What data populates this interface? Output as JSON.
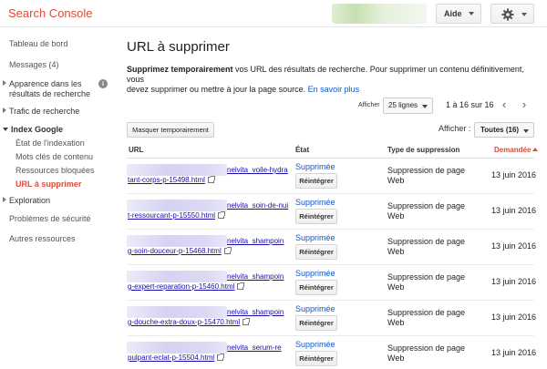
{
  "header": {
    "logo": "Search Console",
    "help_label": "Aide"
  },
  "sidebar": {
    "items": [
      {
        "label": "Tableau de bord"
      },
      {
        "label": "Messages (4)"
      },
      {
        "label_line1": "Apparence dans les",
        "label_line2": "résultats de recherche"
      },
      {
        "label": "Trafic de recherche"
      },
      {
        "label": "Index Google"
      },
      {
        "label": "État de l'indexation"
      },
      {
        "label": "Mots clés de contenu"
      },
      {
        "label": "Ressources bloquées"
      },
      {
        "label": "URL à supprimer"
      },
      {
        "label": "Exploration"
      },
      {
        "label": "Problèmes de sécurité"
      },
      {
        "label": "Autres ressources"
      }
    ],
    "info_icon": "i"
  },
  "main": {
    "title": "URL à supprimer",
    "desc_bold": "Supprimez temporairement",
    "desc_line1_rest": " vos URL des résultats de recherche. Pour supprimer un contenu définitivement, vous",
    "desc_line2": "devez supprimer ou mettre à jour la page source. ",
    "learn_more": "En savoir plus",
    "pager_label": "Afficher",
    "rows_value": "25 lignes",
    "range": "1 à 16 sur 16",
    "prev_icon": "‹",
    "next_icon": "›",
    "hide_button": "Masquer temporairement",
    "filter_label": "Afficher :",
    "filter_value": "Toutes (16)",
    "columns": {
      "url": "URL",
      "state": "État",
      "type": "Type de suppression",
      "requested": "Demandée"
    },
    "rows": [
      {
        "url1": "nelvita_voile-hydra",
        "url2": "tant-corps-p-15498.html",
        "state": "Supprimée",
        "button": "Réintégrer",
        "type": "Suppression de page Web",
        "date": "13 juin 2016"
      },
      {
        "url1": "nelvita_soin-de-nui",
        "url2": "t-ressourcant-p-15550.html",
        "state": "Supprimée",
        "button": "Réintégrer",
        "type": "Suppression de page Web",
        "date": "13 juin 2016"
      },
      {
        "url1": "nelvita_shampoin",
        "url2": "g-soin-douceur-p-15468.html",
        "state": "Supprimée",
        "button": "Réintégrer",
        "type": "Suppression de page Web",
        "date": "13 juin 2016"
      },
      {
        "url1": "nelvita_shampoin",
        "url2": "g-expert-reparation-p-15460.html",
        "state": "Supprimée",
        "button": "Réintégrer",
        "type": "Suppression de page Web",
        "date": "13 juin 2016"
      },
      {
        "url1": "nelvita_shampoin",
        "url2": "g-douche-extra-doux-p-15470.html",
        "state": "Supprimée",
        "button": "Réintégrer",
        "type": "Suppression de page Web",
        "date": "13 juin 2016"
      },
      {
        "url1": "nelvita_serum-re",
        "url2": "pulpant-eclat-p-15504.html",
        "state": "Supprimée",
        "button": "Réintégrer",
        "type": "Suppression de page Web",
        "date": "13 juin 2016"
      }
    ]
  }
}
